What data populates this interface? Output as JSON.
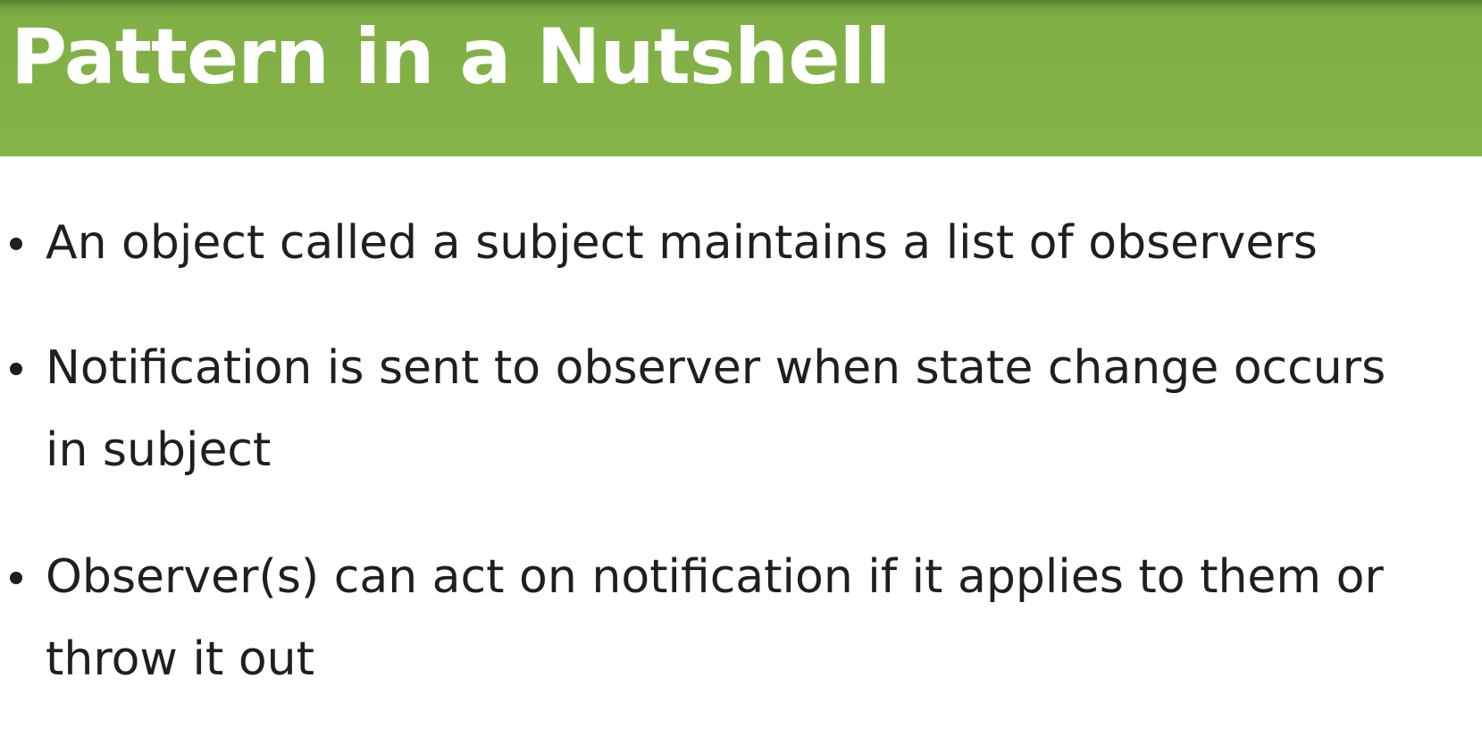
{
  "slide": {
    "title": "Pattern in a Nutshell",
    "header_color": "#84b447",
    "bullets": [
      {
        "lines": [
          "An object called a subject maintains a list of observers"
        ]
      },
      {
        "lines": [
          "Notification is sent to observer when state change occurs",
          "in subject"
        ]
      },
      {
        "lines": [
          "Observer(s) can act on notification if it applies to them or",
          "throw it out"
        ]
      }
    ]
  }
}
